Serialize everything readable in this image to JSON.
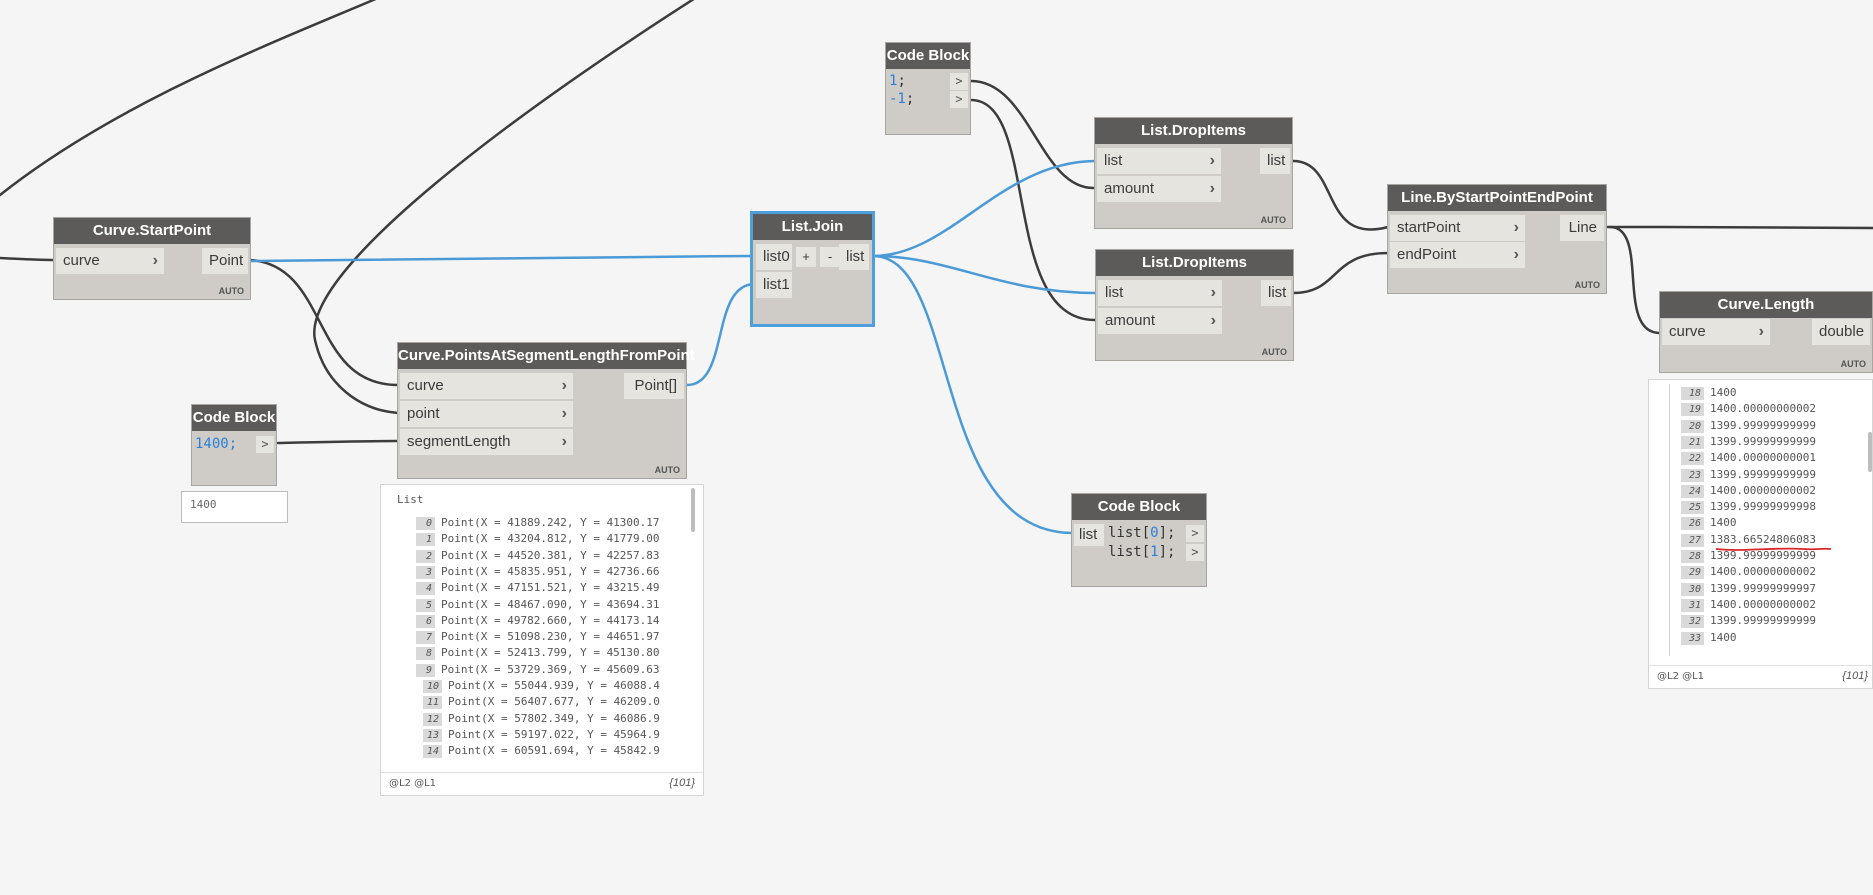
{
  "nodes": {
    "curve_startpoint": {
      "title": "Curve.StartPoint",
      "inputs": [
        "curve"
      ],
      "output": "Point",
      "lacing": "AUTO"
    },
    "code_block_1400": {
      "title": "Code Block",
      "code": "1400;",
      "out": ">",
      "watch_value": "1400"
    },
    "points_at_segment": {
      "title": "Curve.PointsAtSegmentLengthFromPoint",
      "inputs": [
        "curve",
        "point",
        "segmentLength"
      ],
      "output": "Point[]",
      "lacing": "AUTO"
    },
    "list_join": {
      "title": "List.Join",
      "inputs": [
        "list0",
        "list1"
      ],
      "add": "+",
      "remove": "-",
      "output": "list"
    },
    "code_block_top": {
      "title": "Code Block",
      "line1_num": "1",
      "line1_rest": ";",
      "line2_num": "-1",
      "line2_rest": ";",
      "out": ">"
    },
    "drop_items_1": {
      "title": "List.DropItems",
      "inputs": [
        "list",
        "amount"
      ],
      "output": "list",
      "lacing": "AUTO"
    },
    "drop_items_2": {
      "title": "List.DropItems",
      "inputs": [
        "list",
        "amount"
      ],
      "output": "list",
      "lacing": "AUTO"
    },
    "code_block_index": {
      "title": "Code Block",
      "input": "list",
      "l1_a": "list[",
      "l1_n": "0",
      "l1_b": "];",
      "l2_a": "list[",
      "l2_n": "1",
      "l2_b": "];",
      "out": ">"
    },
    "line_by_points": {
      "title": "Line.ByStartPointEndPoint",
      "inputs": [
        "startPoint",
        "endPoint"
      ],
      "output": "Line",
      "lacing": "AUTO"
    },
    "curve_length": {
      "title": "Curve.Length",
      "inputs": [
        "curve"
      ],
      "output": "double",
      "lacing": "AUTO"
    }
  },
  "points_preview": {
    "header": "List",
    "rows": [
      {
        "i": "0",
        "v": "Point(X = 41889.242, Y = 41300.17"
      },
      {
        "i": "1",
        "v": "Point(X = 43204.812, Y = 41779.00"
      },
      {
        "i": "2",
        "v": "Point(X = 44520.381, Y = 42257.83"
      },
      {
        "i": "3",
        "v": "Point(X = 45835.951, Y = 42736.66"
      },
      {
        "i": "4",
        "v": "Point(X = 47151.521, Y = 43215.49"
      },
      {
        "i": "5",
        "v": "Point(X = 48467.090, Y = 43694.31"
      },
      {
        "i": "6",
        "v": "Point(X = 49782.660, Y = 44173.14"
      },
      {
        "i": "7",
        "v": "Point(X = 51098.230, Y = 44651.97"
      },
      {
        "i": "8",
        "v": "Point(X = 52413.799, Y = 45130.80"
      },
      {
        "i": "9",
        "v": "Point(X = 53729.369, Y = 45609.63"
      },
      {
        "i": "10",
        "v": "Point(X = 55044.939, Y = 46088.4"
      },
      {
        "i": "11",
        "v": "Point(X = 56407.677, Y = 46209.0"
      },
      {
        "i": "12",
        "v": "Point(X = 57802.349, Y = 46086.9"
      },
      {
        "i": "13",
        "v": "Point(X = 59197.022, Y = 45964.9"
      },
      {
        "i": "14",
        "v": "Point(X = 60591.694, Y = 45842.9"
      }
    ],
    "levels": "@L2 @L1",
    "count": "{101}"
  },
  "length_preview": {
    "rows": [
      {
        "i": "18",
        "v": "1400"
      },
      {
        "i": "19",
        "v": "1400.00000000002"
      },
      {
        "i": "20",
        "v": "1399.99999999999"
      },
      {
        "i": "21",
        "v": "1399.99999999999"
      },
      {
        "i": "22",
        "v": "1400.00000000001"
      },
      {
        "i": "23",
        "v": "1399.99999999999"
      },
      {
        "i": "24",
        "v": "1400.00000000002"
      },
      {
        "i": "25",
        "v": "1399.99999999998"
      },
      {
        "i": "26",
        "v": "1400"
      },
      {
        "i": "27",
        "v": "1383.66524806083"
      },
      {
        "i": "28",
        "v": "1399.99999999999"
      },
      {
        "i": "29",
        "v": "1400.00000000002"
      },
      {
        "i": "30",
        "v": "1399.99999999997"
      },
      {
        "i": "31",
        "v": "1400.00000000002"
      },
      {
        "i": "32",
        "v": "1399.99999999999"
      },
      {
        "i": "33",
        "v": "1400"
      }
    ],
    "levels": "@L2 @L1",
    "count": "{101}",
    "highlight_color": "#d9262b"
  },
  "colors": {
    "selected_wire": "#4a9ad8",
    "wire": "#3c3c3c",
    "header": "#5c5b59"
  }
}
